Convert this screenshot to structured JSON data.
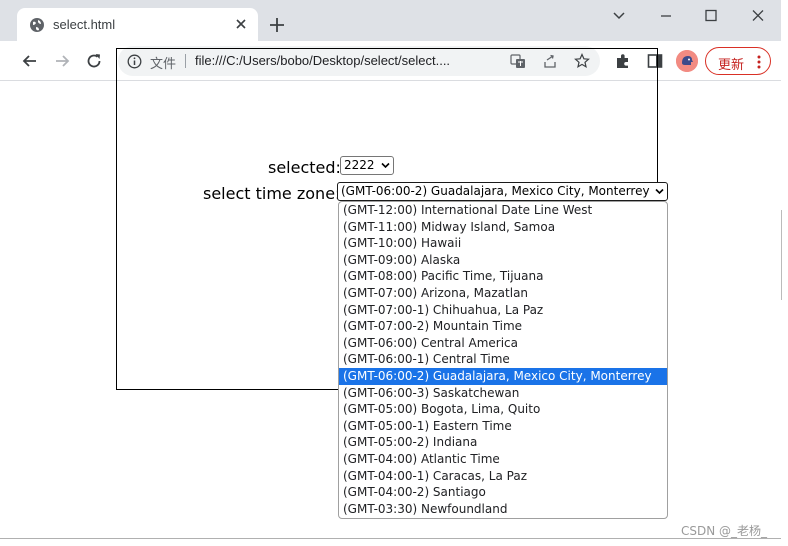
{
  "browser": {
    "tab_title": "select.html",
    "omnibox_label": "文件",
    "url": "file:///C:/Users/bobo/Desktop/select/select....",
    "update_button": "更新"
  },
  "form": {
    "selected_label": "selected:",
    "selected_value": "2222",
    "timezone_label": "select time zone:",
    "timezone_value": "(GMT-06:00-2) Guadalajara, Mexico City, Monterrey"
  },
  "timezone_options": [
    "(GMT-12:00) International Date Line West",
    "(GMT-11:00) Midway Island, Samoa",
    "(GMT-10:00) Hawaii",
    "(GMT-09:00) Alaska",
    "(GMT-08:00) Pacific Time, Tijuana",
    "(GMT-07:00) Arizona, Mazatlan",
    "(GMT-07:00-1) Chihuahua, La Paz",
    "(GMT-07:00-2) Mountain Time",
    "(GMT-06:00) Central America",
    "(GMT-06:00-1) Central Time",
    "(GMT-06:00-2) Guadalajara, Mexico City, Monterrey",
    "(GMT-06:00-3) Saskatchewan",
    "(GMT-05:00) Bogota, Lima, Quito",
    "(GMT-05:00-1) Eastern Time",
    "(GMT-05:00-2) Indiana",
    "(GMT-04:00) Atlantic Time",
    "(GMT-04:00-1) Caracas, La Paz",
    "(GMT-04:00-2) Santiago",
    "(GMT-03:30) Newfoundland"
  ],
  "selected_option_index": 10,
  "watermark": "CSDN @_老杨_",
  "colors": {
    "selection_highlight": "#1a73e8",
    "update_accent": "#d93025",
    "tabstrip": "#dee1e6"
  }
}
